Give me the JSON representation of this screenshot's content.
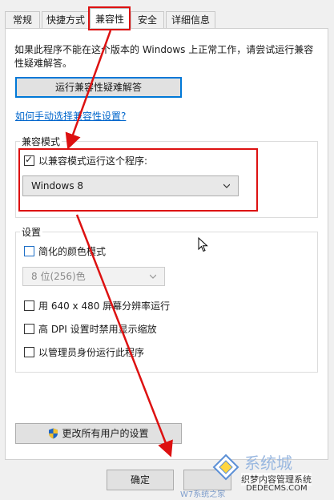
{
  "tabs": [
    {
      "label": "常规"
    },
    {
      "label": "快捷方式"
    },
    {
      "label": "兼容性"
    },
    {
      "label": "安全"
    },
    {
      "label": "详细信息"
    }
  ],
  "intro_text": "如果此程序不能在这个版本的 Windows 上正常工作，请尝试运行兼容性疑难解答。",
  "troubleshoot_button": "运行兼容性疑难解答",
  "manual_link": "如何手动选择兼容性设置?",
  "compat_group": {
    "title": "兼容模式",
    "checkbox_label": "以兼容模式运行这个程序:",
    "checked": true,
    "selected_os": "Windows 8"
  },
  "settings_group": {
    "title": "设置",
    "reduced_color_label": "简化的颜色模式",
    "color_select": "8 位(256)色",
    "options": [
      {
        "label": "用 640 x 480 屏幕分辨率运行"
      },
      {
        "label": "高 DPI 设置时禁用显示缩放"
      },
      {
        "label": "以管理员身份运行此程序"
      }
    ]
  },
  "all_users_button": "更改所有用户的设置",
  "ok_button": "确定",
  "watermark": {
    "brand": "系统城",
    "line1": "织梦内容管理系统",
    "line2": "DEDECMS.COM",
    "bottom": "W7系统之家"
  },
  "colors": {
    "annotation_red": "#dd1111",
    "link_blue": "#0066cc",
    "focus_blue": "#0078d7"
  }
}
